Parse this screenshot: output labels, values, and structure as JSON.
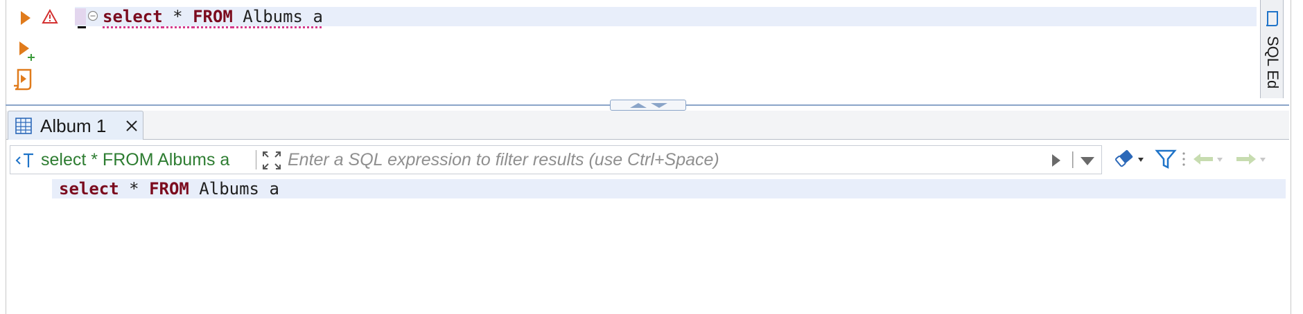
{
  "editor": {
    "line1": {
      "kw_select": "select",
      "star": " * ",
      "kw_from": "FROM",
      "rest": " Albums a"
    },
    "side_tab_label": "SQL Ed",
    "icons": {
      "run_statement": "play-triangle-icon",
      "warning": "warning-triangle-icon",
      "run_new_tab": "play-plus-icon",
      "execute_script": "script-play-icon",
      "fold": "fold-minus-icon",
      "sql_editor_tab": "sql-editor-icon"
    }
  },
  "results": {
    "tab_label": "Album 1",
    "query_label": "select * FROM Albums a",
    "filter_placeholder": "Enter a SQL expression to filter results (use Ctrl+Space)",
    "query_text": {
      "kw_select": "select",
      "star": " * ",
      "kw_from": "FROM",
      "rest": " Albums a"
    }
  },
  "colors": {
    "keyword": "#7b0b1e",
    "run_orange": "#e07b1c",
    "warning_red": "#d32f2f",
    "query_green": "#2e7d32",
    "filter_blue": "#1e73c8",
    "current_line": "#e8eefa"
  }
}
